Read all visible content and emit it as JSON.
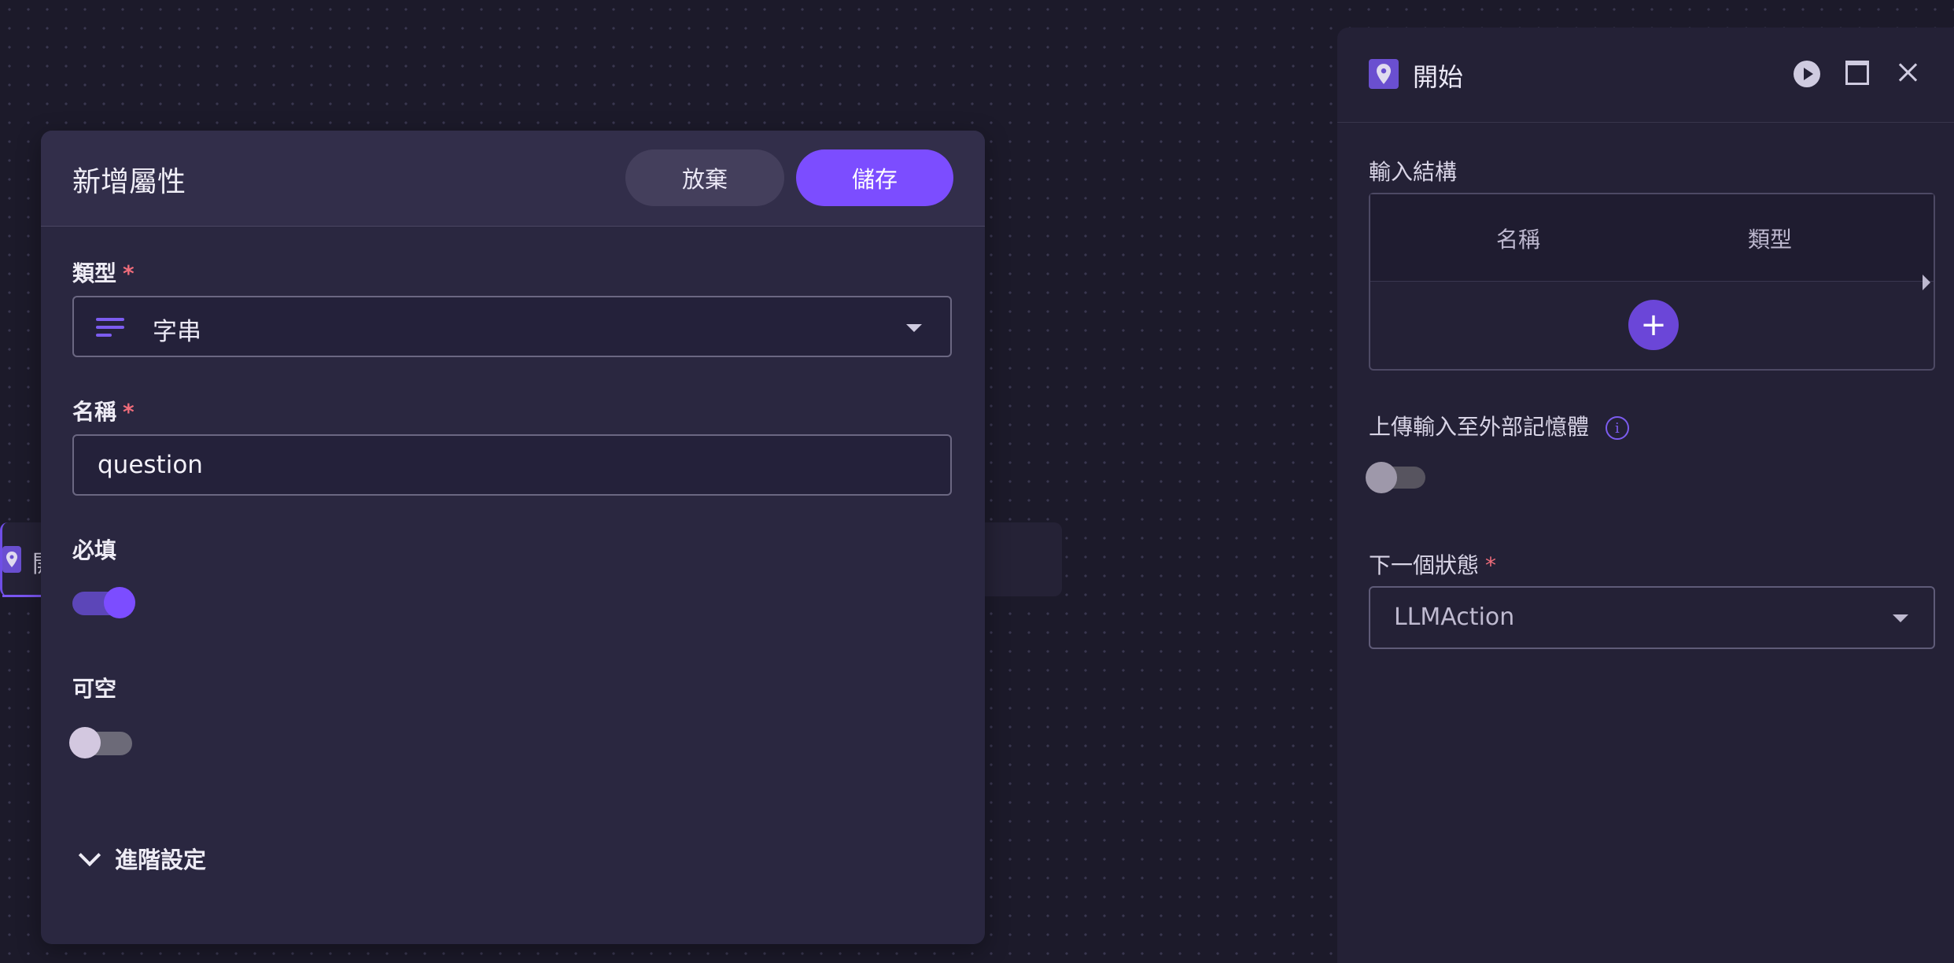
{
  "background_node": {
    "label_fragment": "開"
  },
  "dialog": {
    "title": "新增屬性",
    "discard_label": "放棄",
    "save_label": "儲存",
    "type_label": "類型",
    "type_value": "字串",
    "name_label": "名稱",
    "name_value": "question",
    "required_label": "必填",
    "required_on": true,
    "nullable_label": "可空",
    "nullable_on": false,
    "advanced_label": "進階設定",
    "required_marker": "*"
  },
  "panel": {
    "title": "開始",
    "input_schema_label": "輸入結構",
    "columns": {
      "name": "名稱",
      "type": "類型"
    },
    "add_symbol": "+",
    "upload_label": "上傳輸入至外部記憶體",
    "upload_on": false,
    "info_symbol": "i",
    "next_state_label": "下一個狀態",
    "next_state_value": "LLMAction",
    "required_marker": "*"
  },
  "colors": {
    "accent": "#7c4dff",
    "required": "#ef6c7a"
  }
}
